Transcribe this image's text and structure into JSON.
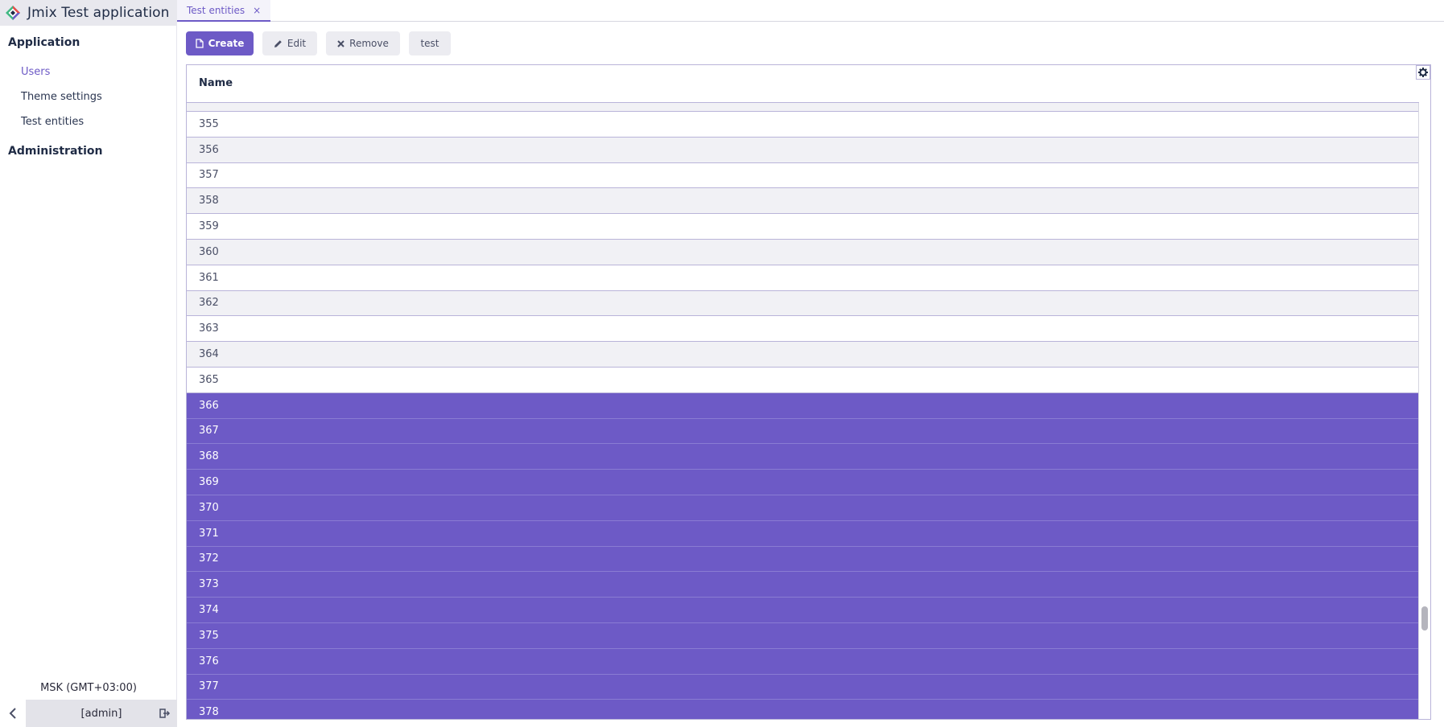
{
  "app": {
    "title": "Jmix Test application"
  },
  "menu": {
    "groups": [
      {
        "label": "Application",
        "items": [
          {
            "label": "Users",
            "active": true
          },
          {
            "label": "Theme settings",
            "active": false
          },
          {
            "label": "Test entities",
            "active": false
          }
        ]
      },
      {
        "label": "Administration",
        "items": []
      }
    ]
  },
  "footer": {
    "timezone": "MSK (GMT+03:00)",
    "user": "[admin]"
  },
  "tabs": [
    {
      "label": "Test entities",
      "close": "×"
    }
  ],
  "toolbar": {
    "create_label": "Create",
    "edit_label": "Edit",
    "remove_label": "Remove",
    "test_label": "test"
  },
  "table": {
    "column_header": "Name",
    "rows": [
      {
        "name": "355",
        "selected": false
      },
      {
        "name": "356",
        "selected": false
      },
      {
        "name": "357",
        "selected": false
      },
      {
        "name": "358",
        "selected": false
      },
      {
        "name": "359",
        "selected": false
      },
      {
        "name": "360",
        "selected": false
      },
      {
        "name": "361",
        "selected": false
      },
      {
        "name": "362",
        "selected": false
      },
      {
        "name": "363",
        "selected": false
      },
      {
        "name": "364",
        "selected": false
      },
      {
        "name": "365",
        "selected": false
      },
      {
        "name": "366",
        "selected": true
      },
      {
        "name": "367",
        "selected": true
      },
      {
        "name": "368",
        "selected": true
      },
      {
        "name": "369",
        "selected": true
      },
      {
        "name": "370",
        "selected": true
      },
      {
        "name": "371",
        "selected": true
      },
      {
        "name": "372",
        "selected": true
      },
      {
        "name": "373",
        "selected": true
      },
      {
        "name": "374",
        "selected": true
      },
      {
        "name": "375",
        "selected": true
      },
      {
        "name": "376",
        "selected": true
      },
      {
        "name": "377",
        "selected": true
      },
      {
        "name": "378",
        "selected": true
      }
    ]
  },
  "colors": {
    "accent": "#6d5ac6",
    "row_alt": "#f1f1f5",
    "border": "#b9b4d9"
  },
  "icons": {
    "logo": "jmix-logo-icon",
    "create": "file-icon",
    "edit": "pencil-icon",
    "remove": "cross-icon",
    "settings": "gear-icon",
    "collapse": "chevron-left-icon",
    "logout": "logout-icon"
  }
}
